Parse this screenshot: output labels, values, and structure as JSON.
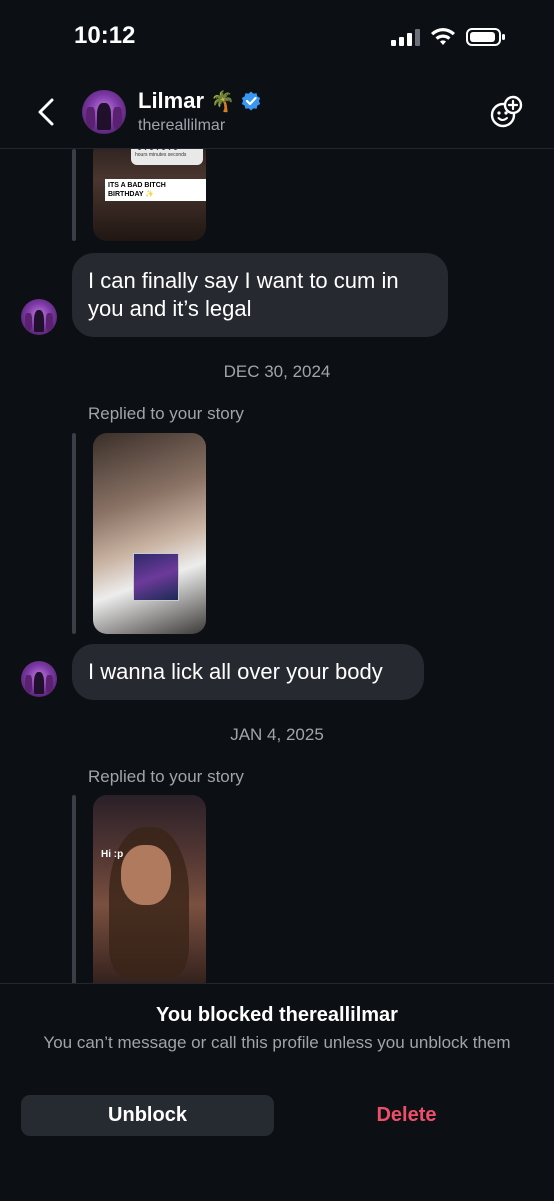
{
  "status_bar": {
    "time": "10:12"
  },
  "header": {
    "name": "Lilmar",
    "emoji": "🌴",
    "handle": "thereallilmar"
  },
  "messages": {
    "story1_countdown": "hours minutes seconds",
    "story1_caption": "ITS A BAD BITCH BIRTHDAY",
    "msg1": "I can finally say I want to cum in you and it’s legal",
    "date1": "DEC 30, 2024",
    "replied1": "Replied to your story",
    "msg2": "I wanna lick all over your body",
    "date2": "JAN 4, 2025",
    "replied2": "Replied to your story",
    "story3_caption": "Hi :p"
  },
  "blocked": {
    "title": "You blocked thereallilmar",
    "description": "You can’t message or call this profile unless you unblock them",
    "unblock_label": "Unblock",
    "delete_label": "Delete"
  },
  "colors": {
    "accent_delete": "#ed4f6a",
    "verified_blue": "#3897f0",
    "bubble": "#26292f"
  },
  "icons": [
    "back-chevron-icon",
    "verified-badge-icon",
    "palm-tree-emoji",
    "effects-icon",
    "signal-icon",
    "wifi-icon",
    "battery-icon"
  ]
}
